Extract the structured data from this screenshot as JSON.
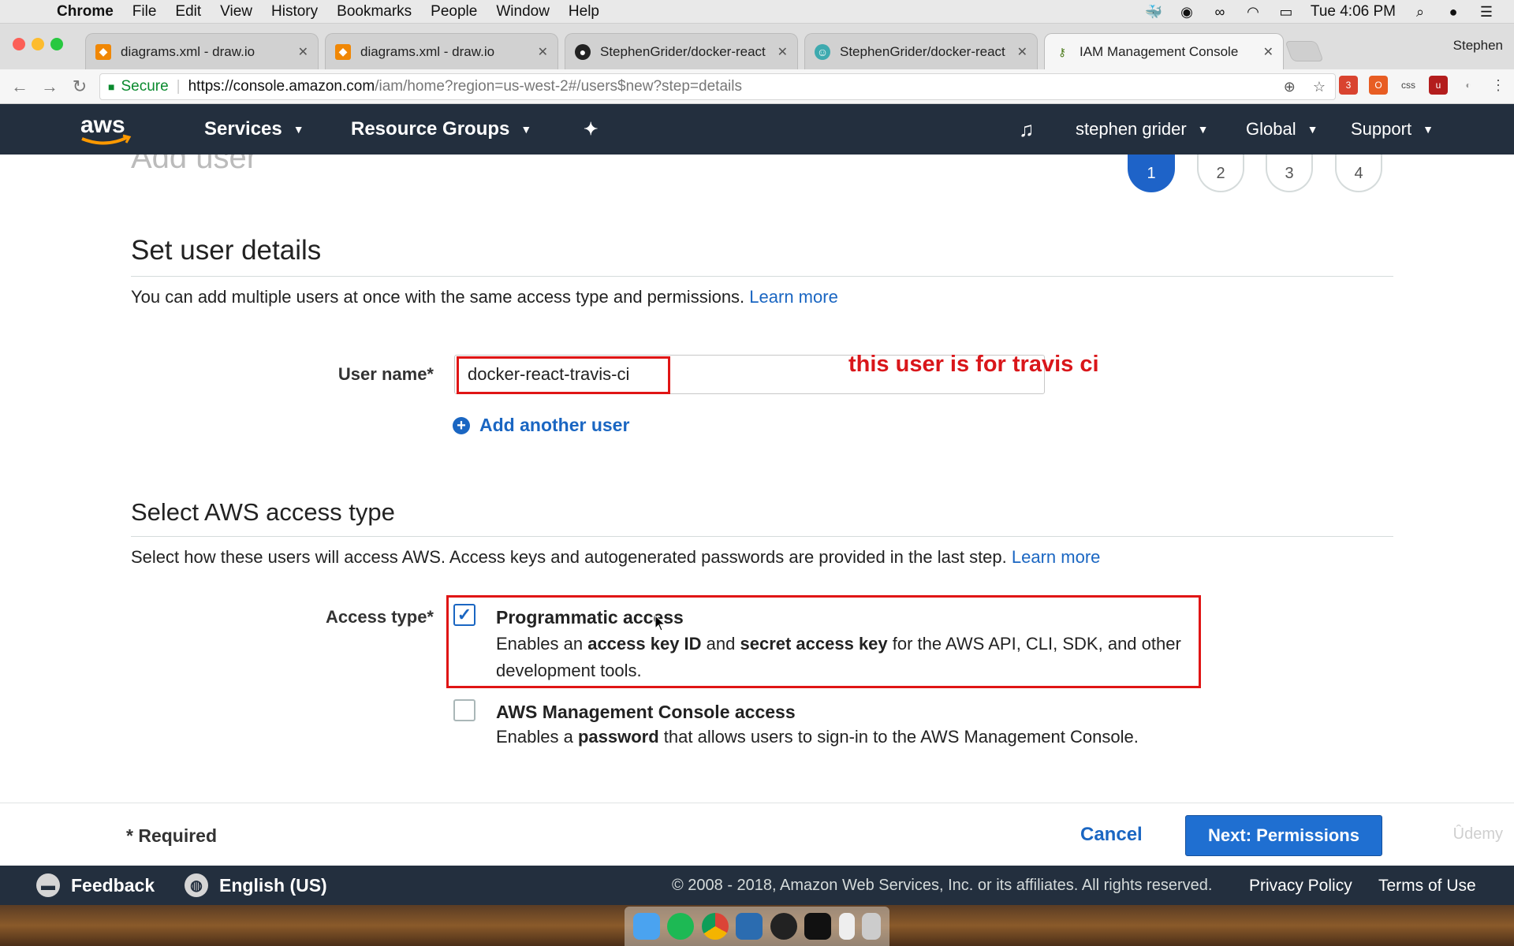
{
  "menubar": {
    "app": "Chrome",
    "items": [
      "File",
      "Edit",
      "View",
      "History",
      "Bookmarks",
      "People",
      "Window",
      "Help"
    ],
    "clock": "Tue 4:06 PM",
    "status_icons": [
      "docker-icon",
      "obs-icon",
      "glasses-icon",
      "wifi-icon",
      "battery-icon",
      "spotlight-icon",
      "siri-icon",
      "list-icon"
    ]
  },
  "tabs": [
    {
      "title": "diagrams.xml - draw.io",
      "favicon": "drawio-icon",
      "active": false
    },
    {
      "title": "diagrams.xml - draw.io",
      "favicon": "drawio-icon",
      "active": false
    },
    {
      "title": "StephenGrider/docker-react",
      "favicon": "github-icon",
      "active": false
    },
    {
      "title": "StephenGrider/docker-react -",
      "favicon": "travis-icon",
      "active": false
    },
    {
      "title": "IAM Management Console",
      "favicon": "aws-iam-icon",
      "active": true
    }
  ],
  "profile_name": "Stephen",
  "address_bar": {
    "secure_label": "Secure",
    "url_host": "https://console.amazon.com",
    "url_path": "/iam/home?region=us-west-2#/users$new?step=details"
  },
  "aws_nav": {
    "services": "Services",
    "resource_groups": "Resource Groups",
    "user": "stephen grider",
    "region": "Global",
    "support": "Support"
  },
  "wizard": {
    "page_title": "Add user",
    "steps": [
      "1",
      "2",
      "3",
      "4"
    ],
    "active_step": 1
  },
  "user_details": {
    "title": "Set user details",
    "description": "You can add multiple users at once with the same access type and permissions.",
    "learn_more": "Learn more",
    "username_label": "User name*",
    "username_value": "docker-react-travis-ci",
    "annotation": "this user is for travis ci",
    "add_another": "Add another user"
  },
  "access_type": {
    "title": "Select AWS access type",
    "description": "Select how these users will access AWS. Access keys and autogenerated passwords are provided in the last step.",
    "learn_more": "Learn more",
    "label": "Access type*",
    "options": [
      {
        "title": "Programmatic access",
        "checked": true,
        "desc_1": "Enables an ",
        "desc_b1": "access key ID",
        "desc_2": " and ",
        "desc_b2": "secret access key",
        "desc_3": " for the AWS API, CLI, SDK, and other development tools."
      },
      {
        "title": "AWS Management Console access",
        "checked": false,
        "desc_1": "Enables a ",
        "desc_b1": "password",
        "desc_2": " that allows users to sign-in to the AWS Management Console."
      }
    ]
  },
  "actions": {
    "required_note": "* Required",
    "cancel": "Cancel",
    "next": "Next: Permissions",
    "watermark": "Ûdemy"
  },
  "footer": {
    "feedback": "Feedback",
    "language": "English (US)",
    "copyright": "© 2008 - 2018, Amazon Web Services, Inc. or its affiliates. All rights reserved.",
    "privacy": "Privacy Policy",
    "terms": "Terms of Use"
  },
  "colors": {
    "aws_nav_bg": "#232f3e",
    "link_blue": "#1a66c2",
    "primary_button": "#1f6fd1",
    "annotation_red": "#e01515"
  }
}
